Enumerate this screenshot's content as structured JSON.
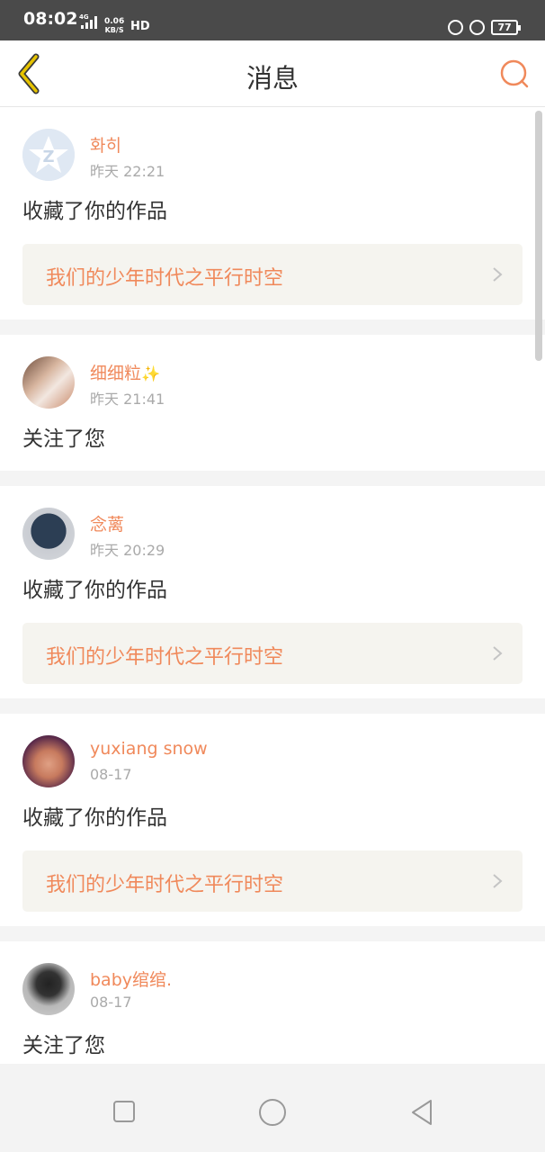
{
  "status_bar": {
    "time": "08:02",
    "network_speed_value": "0.06",
    "network_speed_unit": "KB/S",
    "network_type": "4G",
    "hd_label": "HD",
    "battery": "77"
  },
  "header": {
    "title": "消息"
  },
  "messages": [
    {
      "username": "화히",
      "time": "昨天 22:21",
      "action": "收藏了你的作品",
      "work_title": "我们的少年时代之平行时空",
      "has_emoji": false
    },
    {
      "username": "细细粒",
      "emoji": "✨",
      "time": "昨天 21:41",
      "action": "关注了您"
    },
    {
      "username": "念蓠",
      "time": "昨天 20:29",
      "action": "收藏了你的作品",
      "work_title": "我们的少年时代之平行时空"
    },
    {
      "username": "yuxiang snow",
      "time": "08-17",
      "action": "收藏了你的作品",
      "work_title": "我们的少年时代之平行时空"
    },
    {
      "username": "baby绾绾.",
      "time": "08-17",
      "action": "关注了您"
    }
  ],
  "colors": {
    "accent": "#f0895b",
    "back_icon": "#e6c300"
  }
}
